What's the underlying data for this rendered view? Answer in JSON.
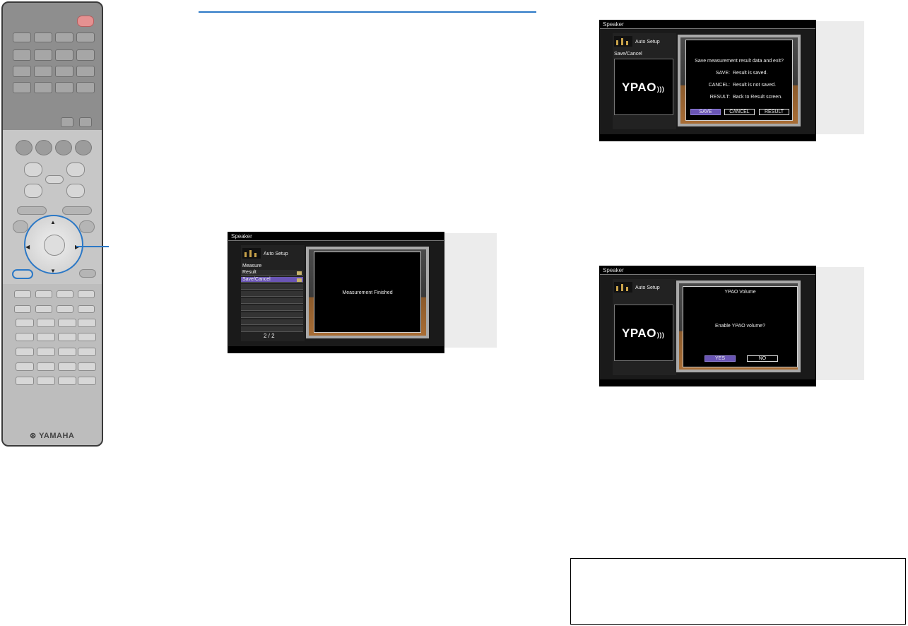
{
  "remote": {
    "brand": "YAMAHA"
  },
  "screen_measure": {
    "title": "Speaker",
    "header": "Auto Setup",
    "menu": [
      "Measure",
      "Result",
      "Save/Cancel"
    ],
    "page": "2 / 2",
    "message": "Measurement Finished"
  },
  "screen_save": {
    "title": "Speaker",
    "header": "Auto Setup",
    "sub": "Save/Cancel",
    "logo": "YPAO",
    "question": "Save measurement result data and exit?",
    "lines": [
      {
        "key": "SAVE:",
        "text": "Result is saved."
      },
      {
        "key": "CANCEL:",
        "text": "Result is not saved."
      },
      {
        "key": "RESULT:",
        "text": "Back to Result screen."
      }
    ],
    "buttons": [
      "SAVE",
      "CANCEL",
      "RESULT"
    ]
  },
  "screen_volume": {
    "title": "Speaker",
    "header": "Auto Setup",
    "logo": "YPAO",
    "heading": "YPAO Volume",
    "question": "Enable YPAO volume?",
    "buttons": [
      "YES",
      "NO"
    ]
  },
  "colors": {
    "accent": "#2b78c6",
    "selection": "#6a55b5"
  }
}
